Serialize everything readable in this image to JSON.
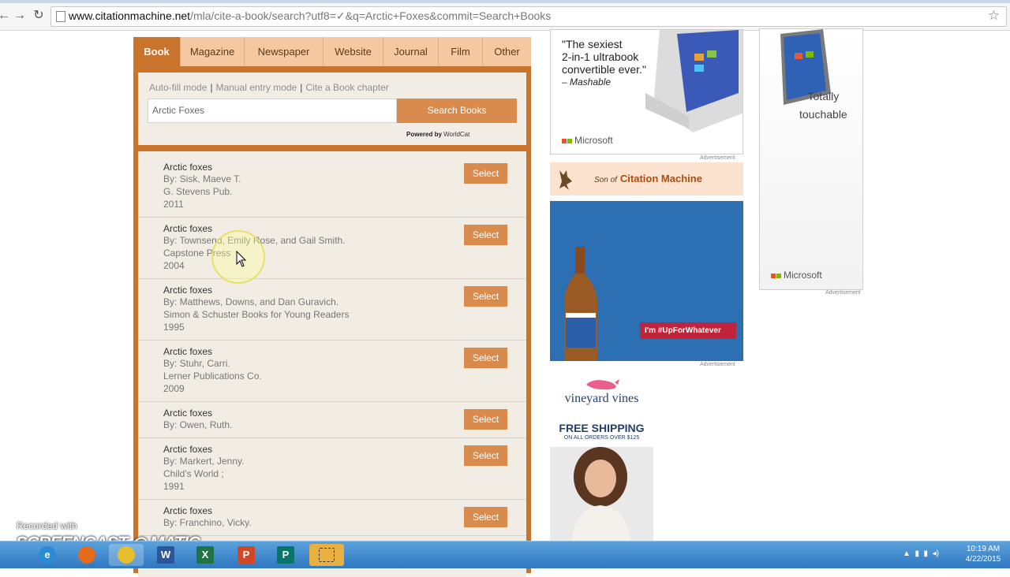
{
  "browser": {
    "url_domain": "www.citationmachine.net",
    "url_path": "/mla/cite-a-book/search?utf8=✓&q=Arctic+Foxes&commit=Search+Books",
    "back_icon": "back-arrow-icon",
    "forward_icon": "forward-arrow-icon",
    "reload_icon": "reload-icon",
    "star_icon": "bookmark-star-icon"
  },
  "tabs": [
    {
      "label": "Book",
      "active": true
    },
    {
      "label": "Magazine"
    },
    {
      "label": "Newspaper"
    },
    {
      "label": "Website"
    },
    {
      "label": "Journal"
    },
    {
      "label": "Film"
    },
    {
      "label": "Other"
    }
  ],
  "search": {
    "modes": [
      "Auto-fill mode",
      "Manual entry mode",
      "Cite a Book chapter"
    ],
    "separator": "|",
    "query": "Arctic Foxes",
    "button_label": "Search Books",
    "powered_by": "Powered by",
    "powered_brand": "WorldCat"
  },
  "results": [
    {
      "title": "Arctic foxes",
      "lines": [
        "By: Sisk, Maeve T.",
        "G. Stevens Pub.",
        "2011"
      ],
      "button": "Select"
    },
    {
      "title": "Arctic foxes",
      "lines": [
        "By: Townsend, Emily Rose, and Gail Smith.",
        "Capstone Press",
        "2004"
      ],
      "button": "Select"
    },
    {
      "title": "Arctic foxes",
      "lines": [
        "By: Matthews, Downs, and Dan Guravich.",
        "Simon & Schuster Books for Young Readers",
        "1995"
      ],
      "button": "Select"
    },
    {
      "title": "Arctic foxes",
      "lines": [
        "By: Stuhr, Carri.",
        "Lerner Publications Co.",
        "2009"
      ],
      "button": "Select"
    },
    {
      "title": "Arctic foxes",
      "lines": [
        "By: Owen, Ruth."
      ],
      "button": "Select"
    },
    {
      "title": "Arctic foxes",
      "lines": [
        "By: Markert, Jenny.",
        "Child's World ;",
        "1991"
      ],
      "button": "Select"
    },
    {
      "title": "Arctic foxes",
      "lines": [
        "By: Franchino, Vicky."
      ],
      "button": "Select"
    }
  ],
  "ads": {
    "microsoft_quote": "\"The sexiest 2-in-1 ultrabook convertible ever.\"",
    "microsoft_quote_l1": "\"The sexiest",
    "microsoft_quote_l2": "2-in-1 ultrabook",
    "microsoft_quote_l3": "convertible ever.\"",
    "microsoft_source": "– Mashable",
    "microsoft_brand": "Microsoft",
    "advertisement_label": "Advertisement",
    "son_of": "Son of",
    "citation_machine": "Citation Machine",
    "bud_tag": "I'm #UpForWhatever",
    "vv_brand": "vineyard vines",
    "vv_free_shipping": "FREE SHIPPING",
    "vv_orders": "ON ALL ORDERS OVER $125",
    "tablet_line1": "Totally",
    "tablet_line2": "touchable",
    "tablet_brand": "Microsoft"
  },
  "watermark": {
    "recorded": "Recorded with",
    "brand": "SCREENCAST ◎ MATIC"
  },
  "taskbar": {
    "apps": [
      "ie-icon",
      "firefox-icon",
      "chrome-icon",
      "word-icon",
      "excel-icon",
      "powerpoint-icon",
      "publisher-icon",
      "snipping-icon"
    ],
    "time": "10:19 AM",
    "date": "4/22/2015"
  },
  "colors": {
    "accent": "#c9742d",
    "button": "#d98b4d",
    "tab_bg": "#f6c8a2",
    "panel_bg": "#f1ede5"
  }
}
